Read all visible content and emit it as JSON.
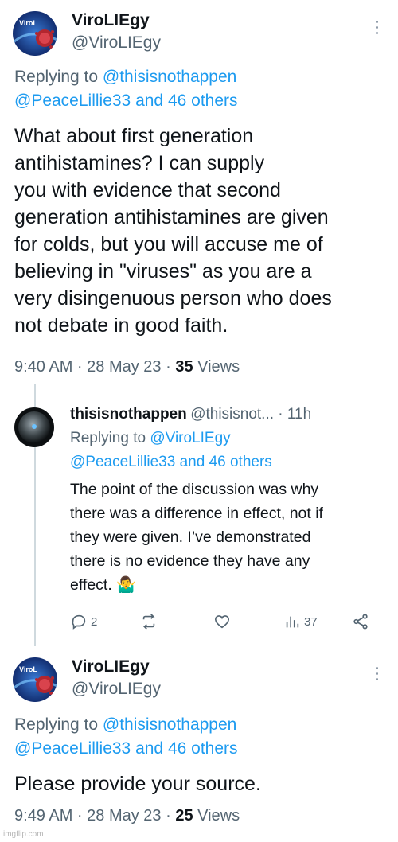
{
  "tweet1": {
    "display_name": "ViroLIEgy",
    "handle": "@ViroLIEgy",
    "replying_prefix": "Replying to ",
    "replying_mention1": "@thisisnothappen",
    "replying_mention2": "@PeaceLillie33 and 46 others",
    "body_lines": [
      "What about first generation",
      "antihistamines? I can supply",
      "you with evidence that second",
      "generation antihistamines are given",
      "for colds, but you will accuse me of",
      "believing in \"viruses\" as you are a",
      "very disingenuous person who does",
      "not debate in good faith."
    ],
    "time": "9:40 AM · 28 May 23 · ",
    "views_count": "35",
    "views_label": " Views"
  },
  "reply": {
    "display_name": "thisisnothappen",
    "handle": "@thisisnot...",
    "age": " · 11h",
    "replying_prefix": "Replying to ",
    "replying_mention1": "@ViroLIEgy",
    "replying_mention2": "@PeaceLillie33 and 46 others",
    "body_lines": [
      "The point of the discussion was why",
      "there was a difference in effect, not if",
      "they were given. I’ve demonstrated",
      "there is no evidence they have any",
      "effect. 🤷‍♂️"
    ],
    "actions": {
      "replies": "2",
      "retweets": "",
      "likes": "",
      "views": "37"
    },
    "icons": [
      "reply-icon",
      "retweet-icon",
      "like-icon",
      "views-icon",
      "share-icon"
    ]
  },
  "tweet2": {
    "display_name": "ViroLIEgy",
    "handle": "@ViroLIEgy",
    "replying_prefix": "Replying to ",
    "replying_mention1": "@thisisnothappen",
    "replying_mention2": "@PeaceLillie33 and 46 others",
    "body": "Please provide your source.",
    "time": "9:49 AM · 28 May 23 · ",
    "views_count": "25",
    "views_label": " Views"
  },
  "avatar_text": "ViroL",
  "watermark": "imgflip.com",
  "colors": {
    "accent": "#1d9bf0",
    "secondary_text": "#536471",
    "primary_text": "#0f1419"
  }
}
